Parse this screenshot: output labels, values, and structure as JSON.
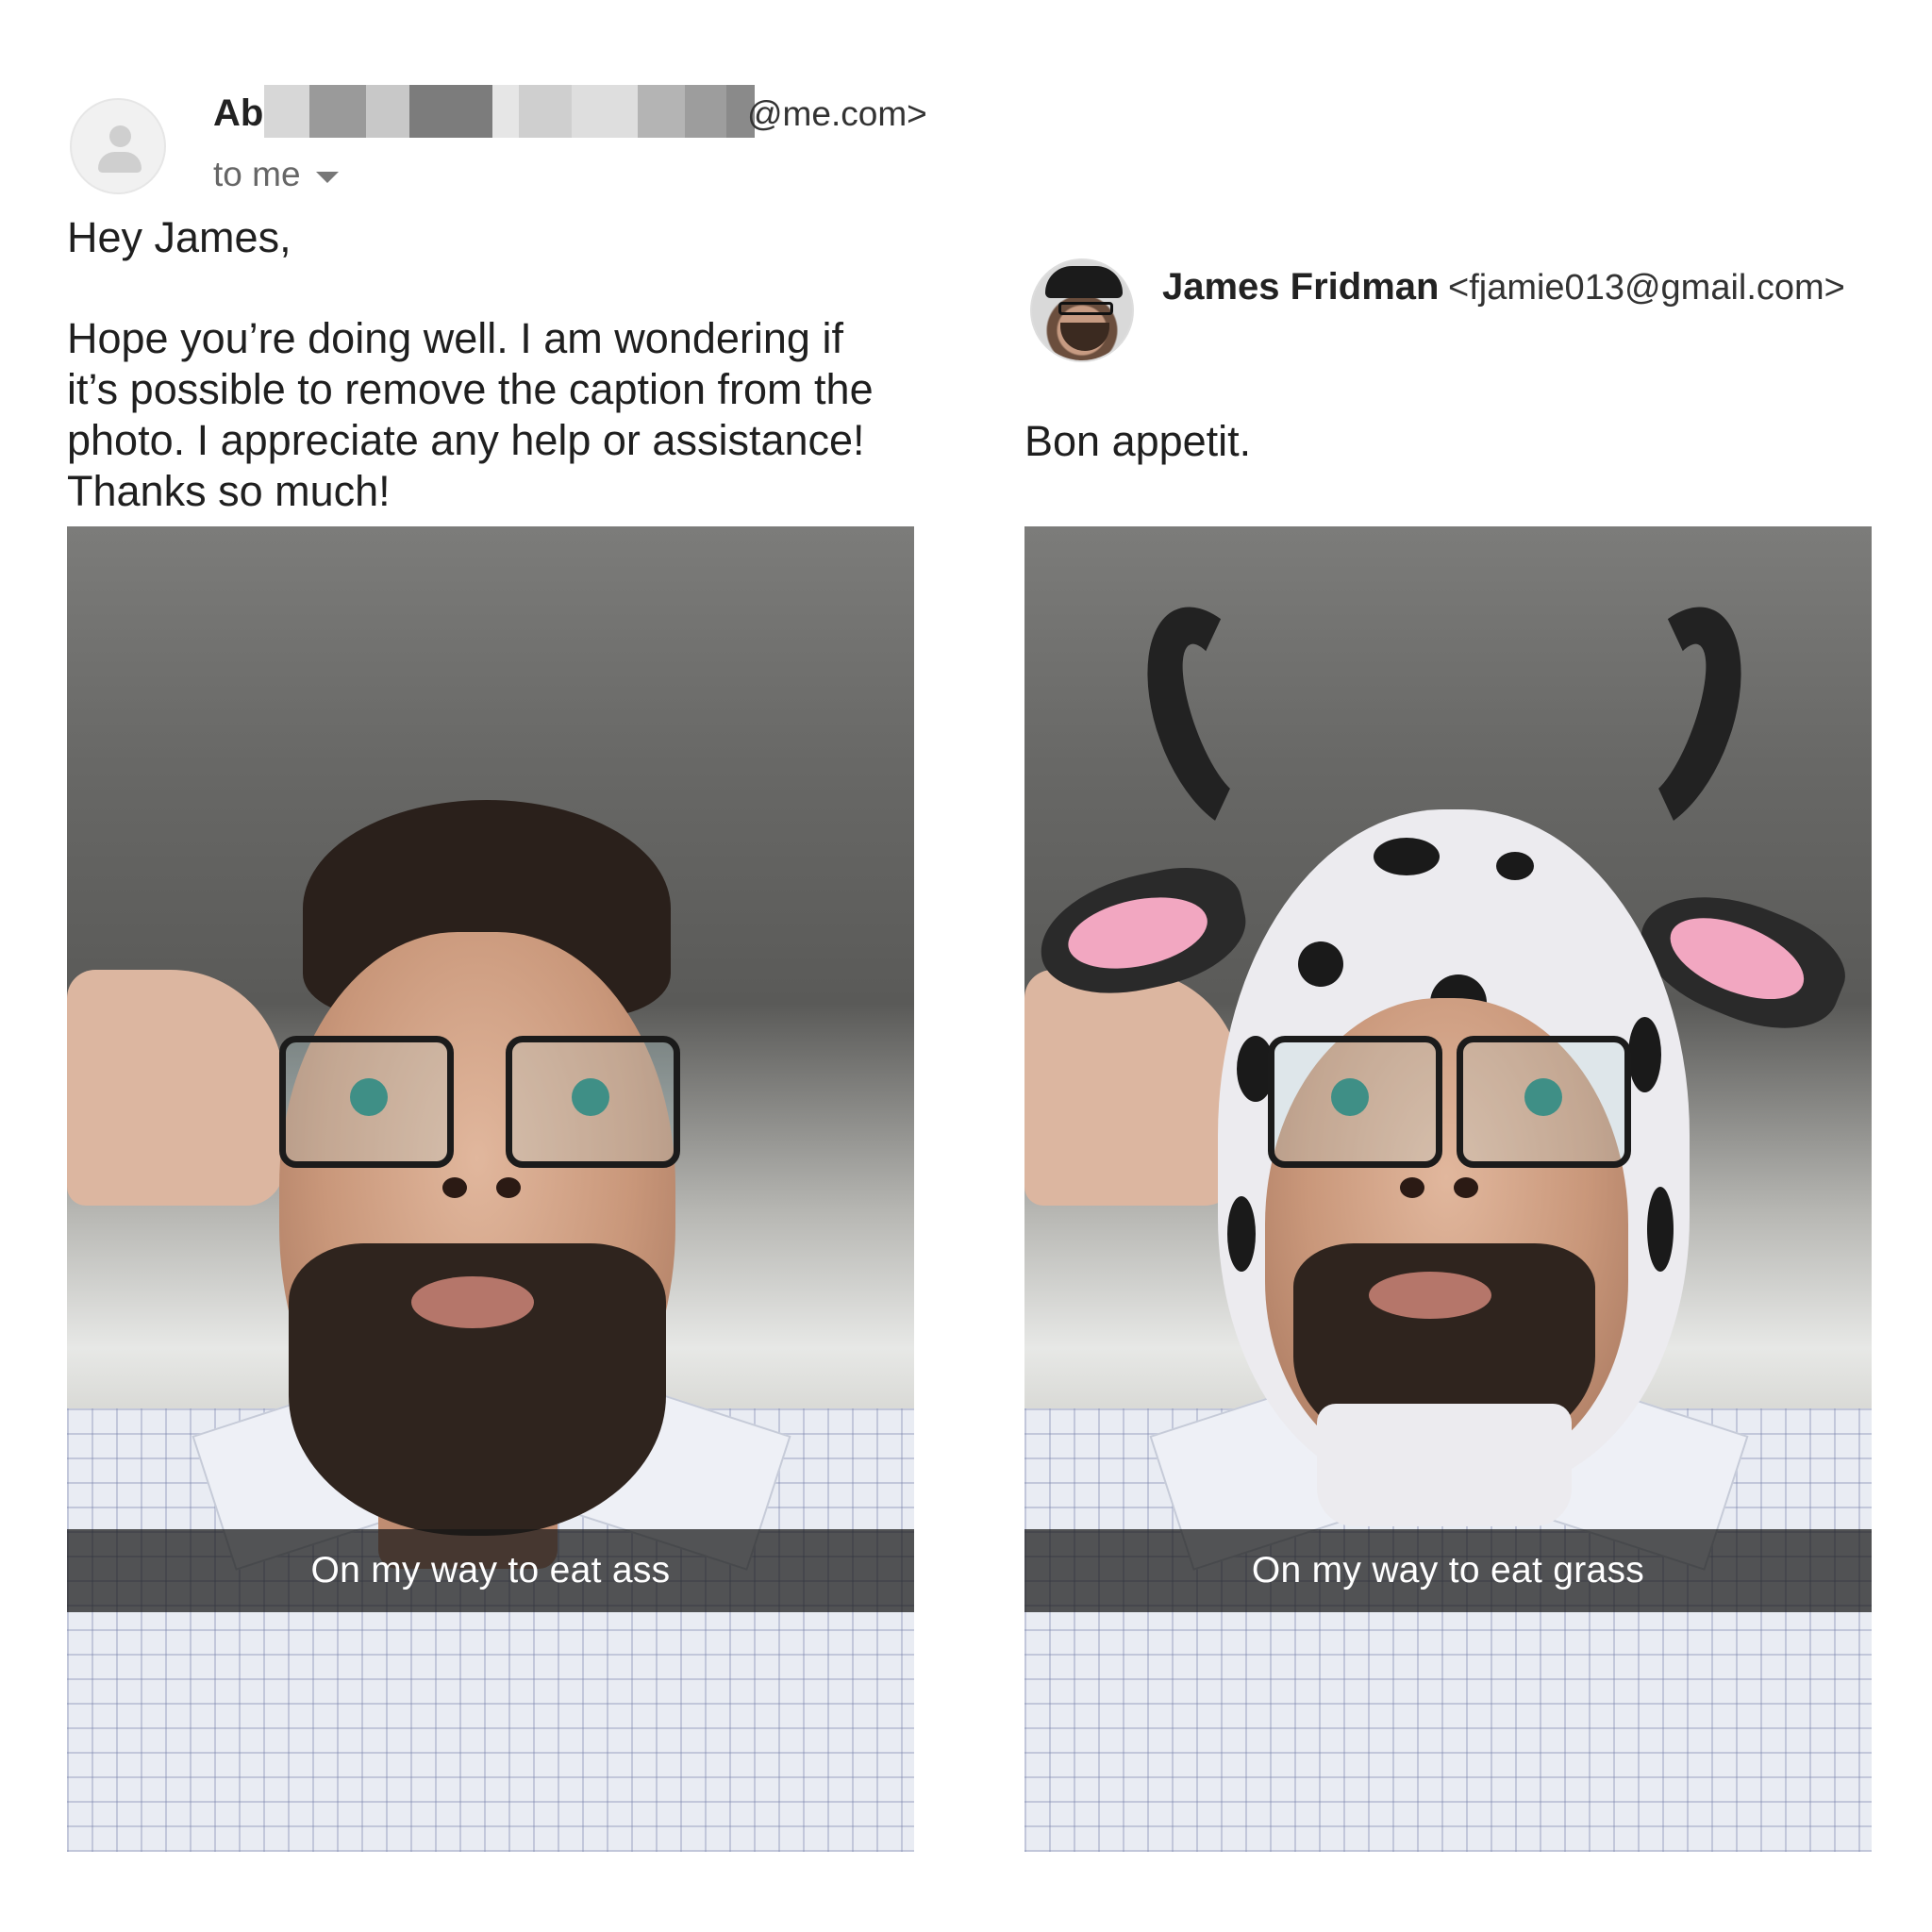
{
  "left_email": {
    "sender_name_visible": "Ab",
    "sender_email_suffix": "@me.com>",
    "recipient_label": "to me",
    "greeting": "Hey James,",
    "body_lines": [
      "Hope you’re doing well. I am wondering if",
      "it’s possible to remove the caption from the",
      "photo. I appreciate any help or assistance!",
      "Thanks so much!"
    ],
    "photo_caption": "On my way to eat ass"
  },
  "right_email": {
    "sender_name": "James Fridman",
    "sender_email": "<fjamie013@gmail.com>",
    "body": "Bon appetit.",
    "photo_caption": "On my way to eat grass"
  },
  "icons": {
    "left_avatar": "default-person-avatar-icon",
    "recipient_dropdown": "caret-down-icon",
    "right_avatar": "profile-photo-avatar"
  },
  "colors": {
    "caption_bar": "#161616",
    "caption_text": "#ffffff",
    "redaction_tones": [
      "#bdbdbd",
      "#7a7a7a",
      "#dcdcdc",
      "#a8a8a8",
      "#eeeeee"
    ]
  }
}
